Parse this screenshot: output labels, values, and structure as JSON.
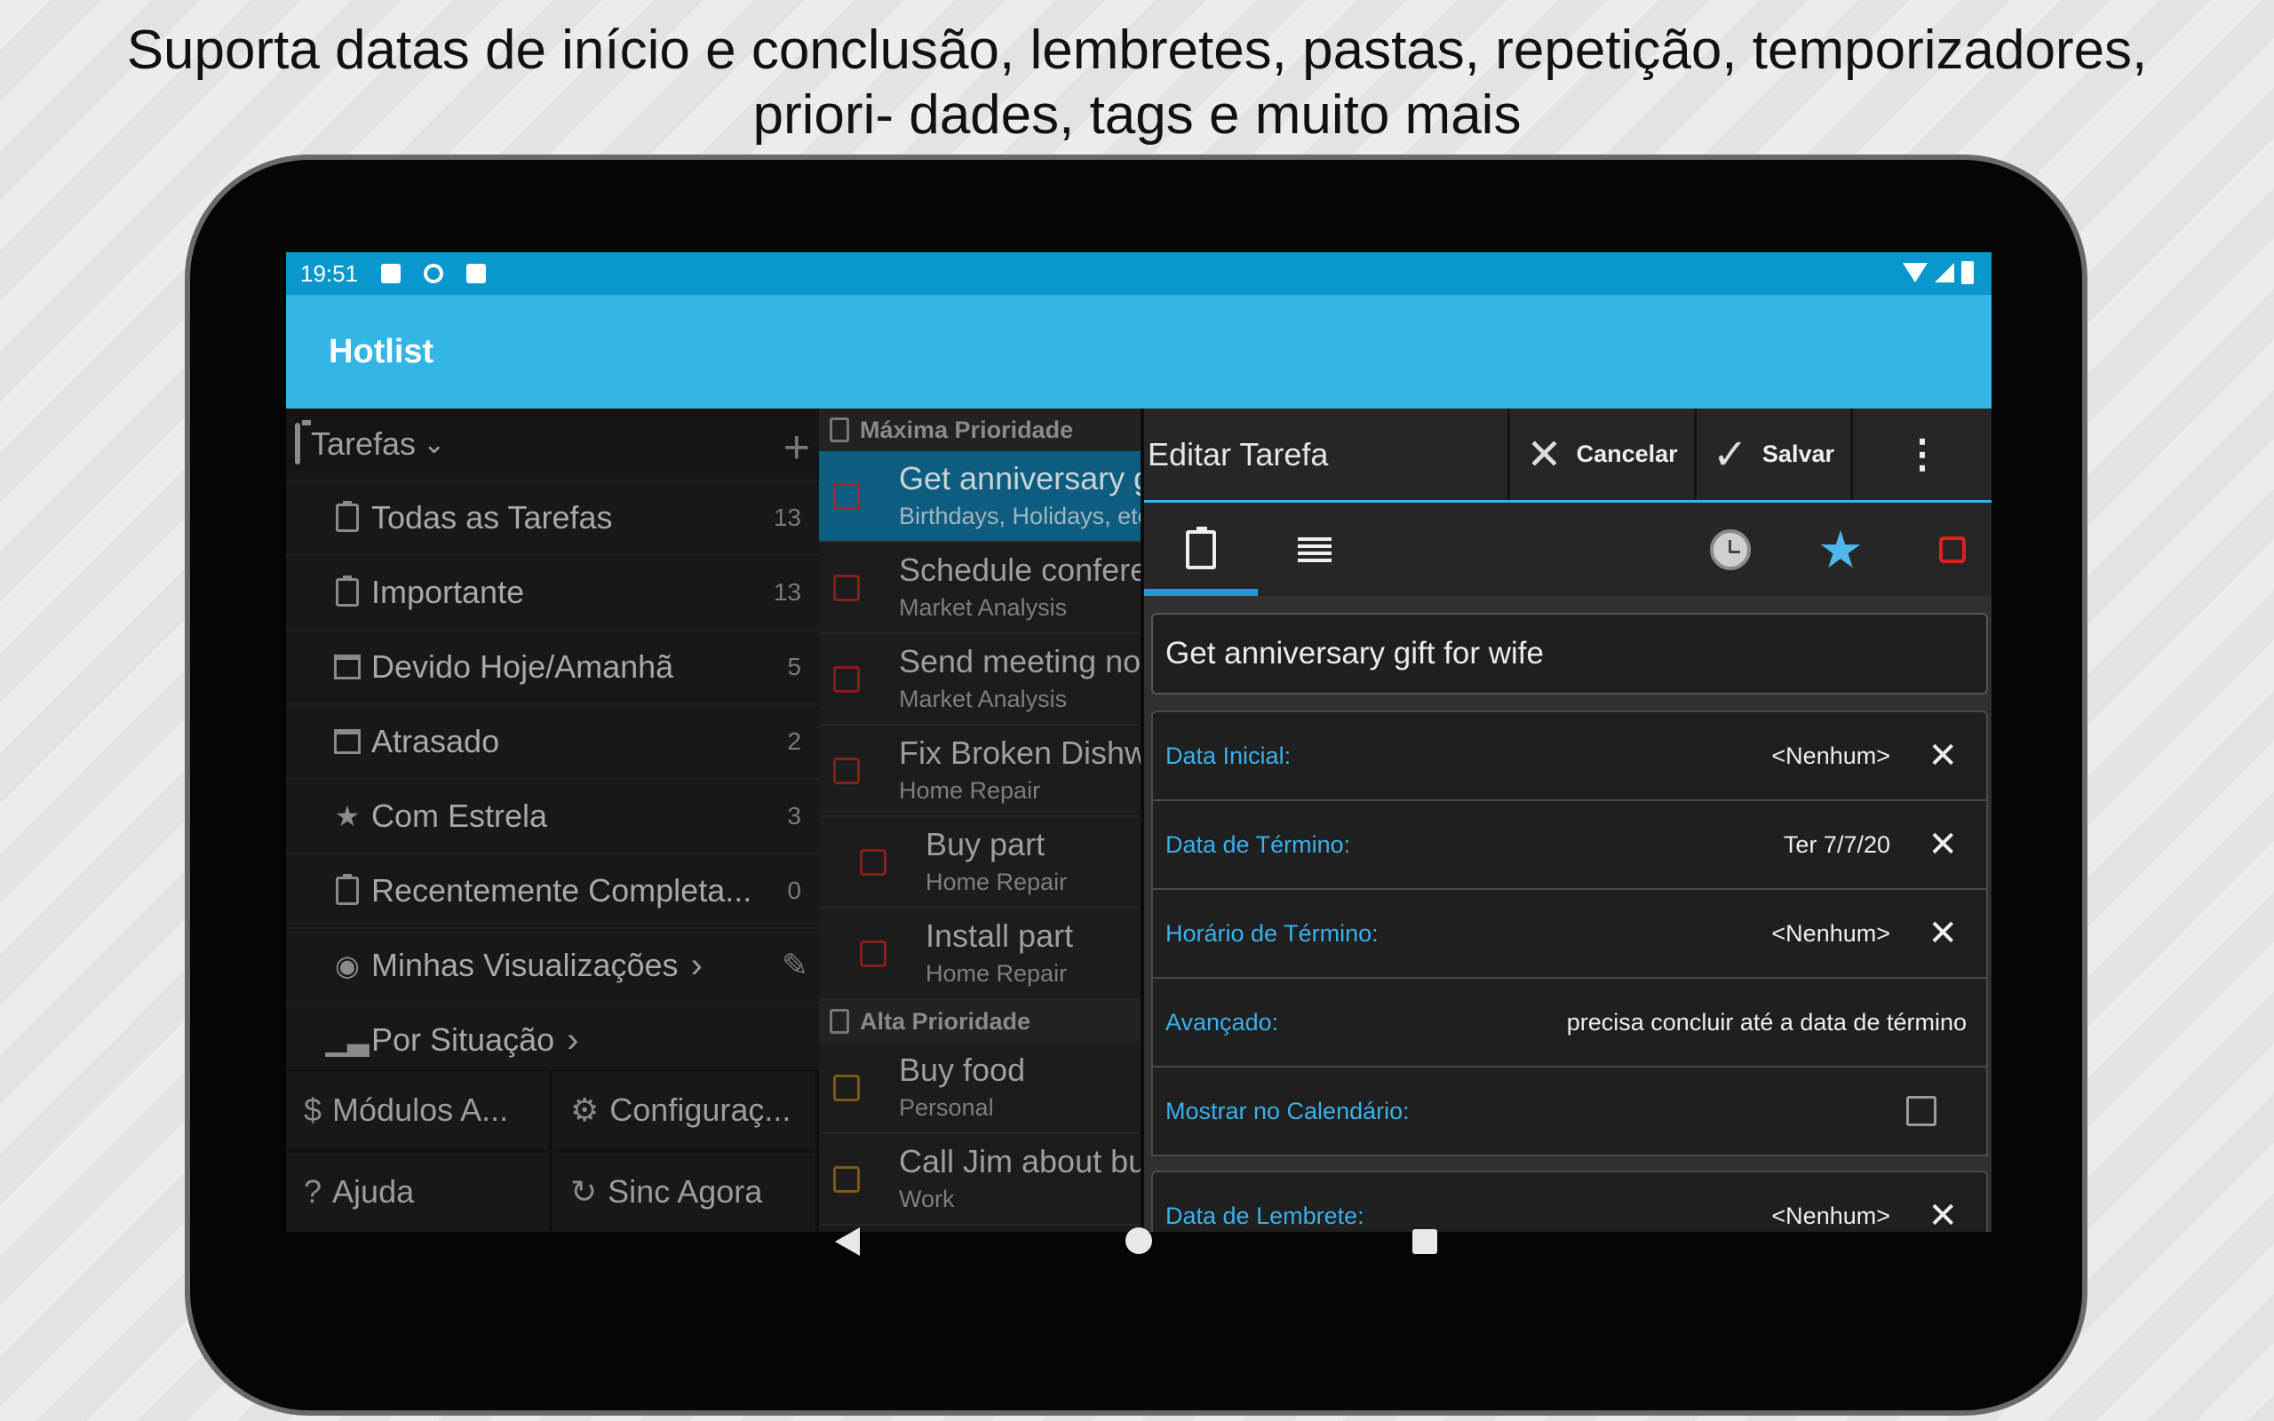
{
  "headline": "Suporta datas de início e conclusão, lembretes, pastas, repetição, temporizadores, priori- dades, tags e muito mais",
  "status_bar": {
    "time": "19:51"
  },
  "app_title": "Hotlist",
  "drawer": {
    "header": "Tarefas",
    "items": [
      {
        "label": "Todas as Tarefas",
        "count": "13"
      },
      {
        "label": "Importante",
        "count": "13"
      },
      {
        "label": "Devido Hoje/Amanhã",
        "count": "5"
      },
      {
        "label": "Atrasado",
        "count": "2"
      },
      {
        "label": "Com Estrela",
        "count": "3"
      },
      {
        "label": "Recentemente Completa...",
        "count": "0"
      },
      {
        "label": "Minhas Visualizações"
      },
      {
        "label": "Por Situação"
      }
    ],
    "footer": [
      {
        "label": "Módulos A...",
        "icon": "dollar-icon"
      },
      {
        "label": "Configuraç...",
        "icon": "gear-icon"
      },
      {
        "label": "Ajuda",
        "icon": "question-icon"
      },
      {
        "label": "Sinc Agora",
        "icon": "sync-icon"
      }
    ]
  },
  "task_list": {
    "groups": [
      {
        "name": "Máxima Prioridade",
        "tasks": [
          {
            "title": "Get anniversary gift for wife",
            "sub": "Birthdays, Holidays, etc"
          },
          {
            "title": "Schedule conference",
            "sub": "Market Analysis"
          },
          {
            "title": "Send meeting notes",
            "sub": "Market Analysis"
          },
          {
            "title": "Fix Broken Dishwasher",
            "sub": "Home Repair"
          },
          {
            "title": "Buy part",
            "sub": "Home Repair"
          },
          {
            "title": "Install part",
            "sub": "Home Repair"
          }
        ]
      },
      {
        "name": "Alta Prioridade",
        "tasks": [
          {
            "title": "Buy food",
            "sub": "Personal"
          },
          {
            "title": "Call Jim about budget",
            "sub": "Work"
          }
        ]
      }
    ]
  },
  "edit": {
    "title": "Editar Tarefa",
    "cancel": "Cancelar",
    "save": "Salvar",
    "task_name": "Get anniversary gift for wife",
    "fields": [
      {
        "label": "Data Inicial:",
        "value": "<Nenhum>"
      },
      {
        "label": "Data de Término:",
        "value": "Ter 7/7/20"
      },
      {
        "label": "Horário de Término:",
        "value": "<Nenhum>"
      },
      {
        "label": "Avançado:",
        "value": "precisa concluir até a data de término"
      },
      {
        "label": "Mostrar no Calendário:"
      },
      {
        "label": "Data de Lembrete:",
        "value": "<Nenhum>"
      }
    ]
  },
  "colors": {
    "accent": "#33b5e5",
    "status_bar": "#0a97cc",
    "label_blue": "#3ab0ea",
    "high_priority": "#e02020"
  }
}
